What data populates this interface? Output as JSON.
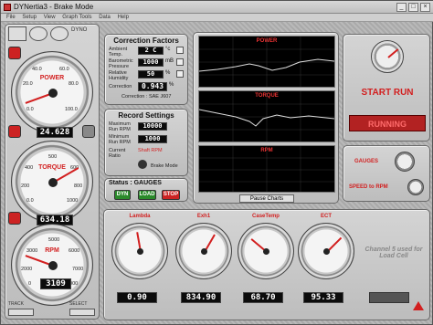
{
  "window": {
    "title": "DYNertia3 - Brake Mode",
    "controls": [
      "_",
      "□",
      "×"
    ]
  },
  "menu": [
    "File",
    "Setup",
    "View",
    "Graph Tools",
    "Data",
    "Help"
  ],
  "toolbar": {
    "dyno": "DYNO"
  },
  "colors": {
    "accent": "#d21f1f",
    "lcd": "#0b0b0b",
    "chart_bg": "#000000"
  },
  "left_gauges": [
    {
      "name": "POWER",
      "readout": "24.628",
      "ticks": [
        "0.0",
        "20.0",
        "40.0",
        "60.0",
        "80.0",
        "100.0"
      ]
    },
    {
      "name": "TORQUE",
      "readout": "634.18",
      "ticks": [
        "0.0",
        "100",
        "200",
        "300",
        "400",
        "500",
        "600",
        "700",
        "800",
        "900",
        "1000"
      ]
    },
    {
      "name": "RPM",
      "readout": "3109",
      "ticks": [
        "0",
        "1000",
        "2000",
        "3000",
        "4000",
        "5000",
        "6000",
        "7000",
        "8000",
        "9000"
      ]
    }
  ],
  "track": "TRACK",
  "select": "SELECT",
  "correction": {
    "title": "Correction Factors",
    "rows": [
      {
        "label": "Ambient Temp.",
        "value": "2 C",
        "unit": "°c"
      },
      {
        "label": "Barometric Pressure",
        "value": "1000",
        "unit": "mB"
      },
      {
        "label": "Relative Humidity",
        "value": "50",
        "unit": "%"
      },
      {
        "label": "Correction",
        "value": "0.943",
        "unit": "%"
      }
    ],
    "standard": "Correction : SAE J607"
  },
  "record": {
    "title": "Record Settings",
    "rows": [
      {
        "label": "Maximum Run RPM",
        "value": "10000"
      },
      {
        "label": "Minimum Run RPM",
        "value": "1000"
      }
    ],
    "current_ratio_label": "Current Ratio",
    "ratio_value": "Shaft RPM",
    "brake_mode": "Brake Mode"
  },
  "status": {
    "text": "Status : GAUGES",
    "buttons": [
      "DYN",
      "LOAD",
      "STOP"
    ]
  },
  "charts": {
    "titles": [
      "POWER",
      "TORQUE",
      "RPM"
    ],
    "pause": "Pause Charts"
  },
  "start": {
    "label": "START RUN",
    "running": "RUNNING"
  },
  "modes": {
    "gauges": "GAUGES",
    "speed": "SPEED to RPM"
  },
  "bottom_gauges": [
    {
      "name": "Lambda",
      "readout": "0.90"
    },
    {
      "name": "Exh1",
      "readout": "834.90"
    },
    {
      "name": "CaseTemp",
      "readout": "68.70"
    },
    {
      "name": "ECT",
      "readout": "95.33"
    }
  ],
  "loadcell_note": "Channel 5 used for Load Cell"
}
